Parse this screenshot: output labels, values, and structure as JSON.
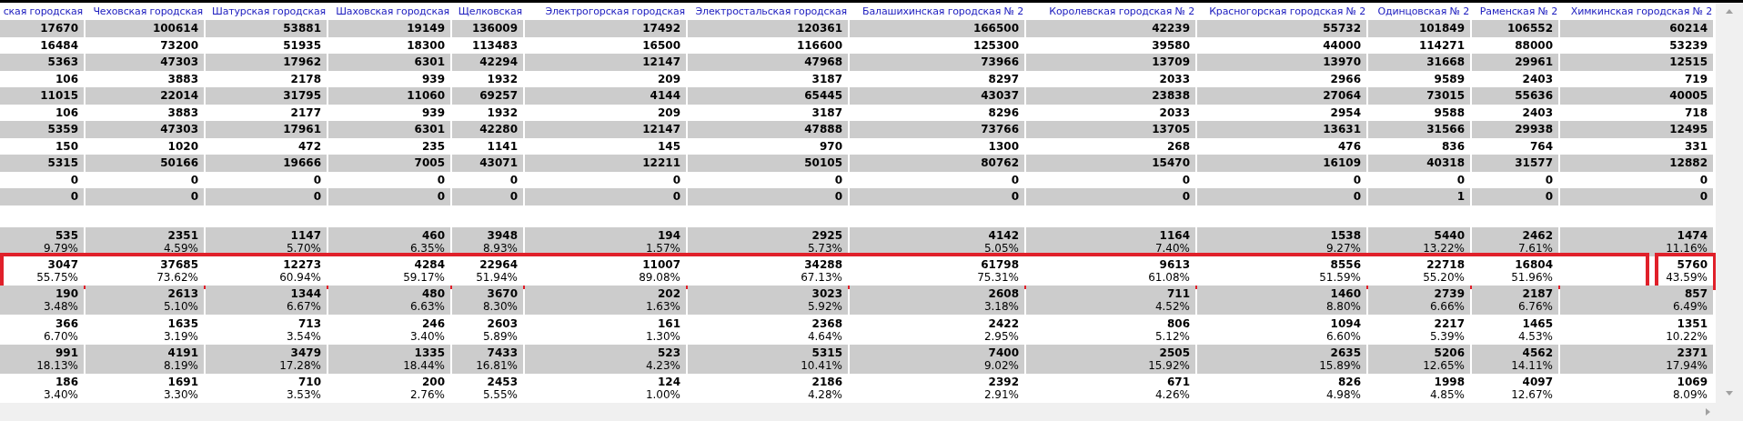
{
  "table": {
    "columns": [
      "ская городская",
      "Чеховская городская",
      "Шатурская городская",
      "Шаховская городская",
      "Щелковская",
      "Электрогорская городская",
      "Электростальская городская",
      "Балашихинская городская № 2",
      "Королевская городская № 2",
      "Красногорская городская № 2",
      "Одинцовская № 2",
      "Раменская № 2",
      "Химкинская городская № 2"
    ],
    "rows": [
      {
        "kind": "number",
        "cells": [
          "17670",
          "100614",
          "53881",
          "19149",
          "136009",
          "17492",
          "120361",
          "166500",
          "42239",
          "55732",
          "101849",
          "106552",
          "60214"
        ]
      },
      {
        "kind": "number",
        "cells": [
          "16484",
          "73200",
          "51935",
          "18300",
          "113483",
          "16500",
          "116600",
          "125300",
          "39580",
          "44000",
          "114271",
          "88000",
          "53239"
        ]
      },
      {
        "kind": "number",
        "cells": [
          "5363",
          "47303",
          "17962",
          "6301",
          "42294",
          "12147",
          "47968",
          "73966",
          "13709",
          "13970",
          "31668",
          "29961",
          "12515"
        ]
      },
      {
        "kind": "number",
        "cells": [
          "106",
          "3883",
          "2178",
          "939",
          "1932",
          "209",
          "3187",
          "8297",
          "2033",
          "2966",
          "9589",
          "2403",
          "719"
        ]
      },
      {
        "kind": "number",
        "cells": [
          "11015",
          "22014",
          "31795",
          "11060",
          "69257",
          "4144",
          "65445",
          "43037",
          "23838",
          "27064",
          "73015",
          "55636",
          "40005"
        ]
      },
      {
        "kind": "number",
        "cells": [
          "106",
          "3883",
          "2177",
          "939",
          "1932",
          "209",
          "3187",
          "8296",
          "2033",
          "2954",
          "9588",
          "2403",
          "718"
        ]
      },
      {
        "kind": "number",
        "cells": [
          "5359",
          "47303",
          "17961",
          "6301",
          "42280",
          "12147",
          "47888",
          "73766",
          "13705",
          "13631",
          "31566",
          "29938",
          "12495"
        ]
      },
      {
        "kind": "number",
        "cells": [
          "150",
          "1020",
          "472",
          "235",
          "1141",
          "145",
          "970",
          "1300",
          "268",
          "476",
          "836",
          "764",
          "331"
        ]
      },
      {
        "kind": "number",
        "cells": [
          "5315",
          "50166",
          "19666",
          "7005",
          "43071",
          "12211",
          "50105",
          "80762",
          "15470",
          "16109",
          "40318",
          "31577",
          "12882"
        ]
      },
      {
        "kind": "number",
        "cells": [
          "0",
          "0",
          "0",
          "0",
          "0",
          "0",
          "0",
          "0",
          "0",
          "0",
          "0",
          "0",
          "0"
        ]
      },
      {
        "kind": "number",
        "cells": [
          "0",
          "0",
          "0",
          "0",
          "0",
          "0",
          "0",
          "0",
          "0",
          "0",
          "1",
          "0",
          "0"
        ]
      },
      {
        "kind": "blank"
      },
      {
        "kind": "share",
        "highlighted": false,
        "cells": [
          {
            "count": "535",
            "share": "9.79%",
            "highlighted": false
          },
          {
            "count": "2351",
            "share": "4.59%",
            "highlighted": false
          },
          {
            "count": "1147",
            "share": "5.70%",
            "highlighted": false
          },
          {
            "count": "460",
            "share": "6.35%",
            "highlighted": false
          },
          {
            "count": "3948",
            "share": "8.93%",
            "highlighted": false
          },
          {
            "count": "194",
            "share": "1.57%",
            "highlighted": false
          },
          {
            "count": "2925",
            "share": "5.73%",
            "highlighted": false
          },
          {
            "count": "4142",
            "share": "5.05%",
            "highlighted": false
          },
          {
            "count": "1164",
            "share": "7.40%",
            "highlighted": false
          },
          {
            "count": "1538",
            "share": "9.27%",
            "highlighted": false
          },
          {
            "count": "5440",
            "share": "13.22%",
            "highlighted": false
          },
          {
            "count": "2462",
            "share": "7.61%",
            "highlighted": false
          },
          {
            "count": "1474",
            "share": "11.16%",
            "highlighted": false
          }
        ]
      },
      {
        "kind": "share",
        "highlighted": true,
        "cells": [
          {
            "count": "3047",
            "share": "55.75%",
            "highlighted": false
          },
          {
            "count": "37685",
            "share": "73.62%",
            "highlighted": false
          },
          {
            "count": "12273",
            "share": "60.94%",
            "highlighted": false
          },
          {
            "count": "4284",
            "share": "59.17%",
            "highlighted": false
          },
          {
            "count": "22964",
            "share": "51.94%",
            "highlighted": false
          },
          {
            "count": "11007",
            "share": "89.08%",
            "highlighted": false
          },
          {
            "count": "34288",
            "share": "67.13%",
            "highlighted": false
          },
          {
            "count": "61798",
            "share": "75.31%",
            "highlighted": false
          },
          {
            "count": "9613",
            "share": "61.08%",
            "highlighted": false
          },
          {
            "count": "8556",
            "share": "51.59%",
            "highlighted": false
          },
          {
            "count": "22718",
            "share": "55.20%",
            "highlighted": false
          },
          {
            "count": "16804",
            "share": "51.96%",
            "highlighted": false
          },
          {
            "count": "5760",
            "share": "43.59%",
            "highlighted": true
          }
        ]
      },
      {
        "kind": "share",
        "highlighted": false,
        "cells": [
          {
            "count": "190",
            "share": "3.48%",
            "highlighted": false
          },
          {
            "count": "2613",
            "share": "5.10%",
            "highlighted": false
          },
          {
            "count": "1344",
            "share": "6.67%",
            "highlighted": false
          },
          {
            "count": "480",
            "share": "6.63%",
            "highlighted": false
          },
          {
            "count": "3670",
            "share": "8.30%",
            "highlighted": false
          },
          {
            "count": "202",
            "share": "1.63%",
            "highlighted": false
          },
          {
            "count": "3023",
            "share": "5.92%",
            "highlighted": false
          },
          {
            "count": "2608",
            "share": "3.18%",
            "highlighted": false
          },
          {
            "count": "711",
            "share": "4.52%",
            "highlighted": false
          },
          {
            "count": "1460",
            "share": "8.80%",
            "highlighted": false
          },
          {
            "count": "2739",
            "share": "6.66%",
            "highlighted": false
          },
          {
            "count": "2187",
            "share": "6.76%",
            "highlighted": false
          },
          {
            "count": "857",
            "share": "6.49%",
            "highlighted": false
          }
        ]
      },
      {
        "kind": "share",
        "highlighted": false,
        "cells": [
          {
            "count": "366",
            "share": "6.70%",
            "highlighted": false
          },
          {
            "count": "1635",
            "share": "3.19%",
            "highlighted": false
          },
          {
            "count": "713",
            "share": "3.54%",
            "highlighted": false
          },
          {
            "count": "246",
            "share": "3.40%",
            "highlighted": false
          },
          {
            "count": "2603",
            "share": "5.89%",
            "highlighted": false
          },
          {
            "count": "161",
            "share": "1.30%",
            "highlighted": false
          },
          {
            "count": "2368",
            "share": "4.64%",
            "highlighted": false
          },
          {
            "count": "2422",
            "share": "2.95%",
            "highlighted": false
          },
          {
            "count": "806",
            "share": "5.12%",
            "highlighted": false
          },
          {
            "count": "1094",
            "share": "6.60%",
            "highlighted": false
          },
          {
            "count": "2217",
            "share": "5.39%",
            "highlighted": false
          },
          {
            "count": "1465",
            "share": "4.53%",
            "highlighted": false
          },
          {
            "count": "1351",
            "share": "10.22%",
            "highlighted": false
          }
        ]
      },
      {
        "kind": "share",
        "highlighted": false,
        "cells": [
          {
            "count": "991",
            "share": "18.13%",
            "highlighted": false
          },
          {
            "count": "4191",
            "share": "8.19%",
            "highlighted": false
          },
          {
            "count": "3479",
            "share": "17.28%",
            "highlighted": false
          },
          {
            "count": "1335",
            "share": "18.44%",
            "highlighted": false
          },
          {
            "count": "7433",
            "share": "16.81%",
            "highlighted": false
          },
          {
            "count": "523",
            "share": "4.23%",
            "highlighted": false
          },
          {
            "count": "5315",
            "share": "10.41%",
            "highlighted": false
          },
          {
            "count": "7400",
            "share": "9.02%",
            "highlighted": false
          },
          {
            "count": "2505",
            "share": "15.92%",
            "highlighted": false
          },
          {
            "count": "2635",
            "share": "15.89%",
            "highlighted": false
          },
          {
            "count": "5206",
            "share": "12.65%",
            "highlighted": false
          },
          {
            "count": "4562",
            "share": "14.11%",
            "highlighted": false
          },
          {
            "count": "2371",
            "share": "17.94%",
            "highlighted": false
          }
        ]
      },
      {
        "kind": "share",
        "highlighted": false,
        "cells": [
          {
            "count": "186",
            "share": "3.40%",
            "highlighted": false
          },
          {
            "count": "1691",
            "share": "3.30%",
            "highlighted": false
          },
          {
            "count": "710",
            "share": "3.53%",
            "highlighted": false
          },
          {
            "count": "200",
            "share": "2.76%",
            "highlighted": false
          },
          {
            "count": "2453",
            "share": "5.55%",
            "highlighted": false
          },
          {
            "count": "124",
            "share": "1.00%",
            "highlighted": false
          },
          {
            "count": "2186",
            "share": "4.28%",
            "highlighted": false
          },
          {
            "count": "2392",
            "share": "2.91%",
            "highlighted": false
          },
          {
            "count": "671",
            "share": "4.26%",
            "highlighted": false
          },
          {
            "count": "826",
            "share": "4.98%",
            "highlighted": false
          },
          {
            "count": "1998",
            "share": "4.85%",
            "highlighted": false
          },
          {
            "count": "4097",
            "share": "12.67%",
            "highlighted": false
          },
          {
            "count": "1069",
            "share": "8.09%",
            "highlighted": false
          }
        ]
      }
    ]
  }
}
